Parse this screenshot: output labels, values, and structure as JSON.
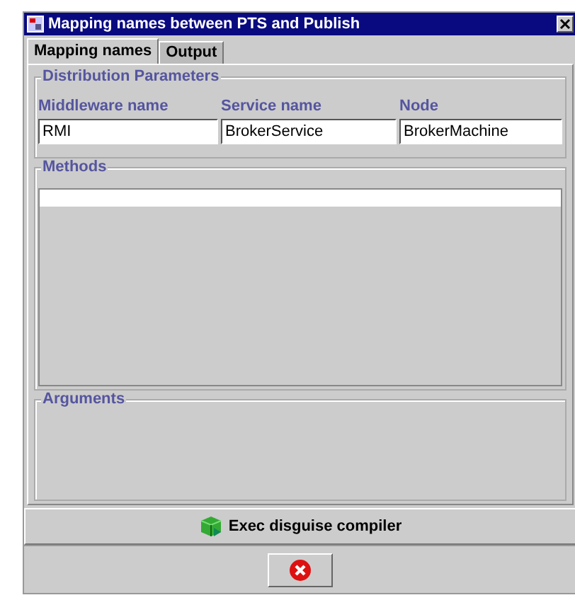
{
  "window": {
    "title": "Mapping names between PTS and Publish"
  },
  "tabs": [
    {
      "label": "Mapping names",
      "selected": true
    },
    {
      "label": "Output",
      "selected": false
    }
  ],
  "distribution_parameters": {
    "title": "Distribution Parameters",
    "fields": [
      {
        "label": "Middleware name",
        "value": "RMI"
      },
      {
        "label": "Service name",
        "value": "BrokerService"
      },
      {
        "label": "Node",
        "value": "BrokerMachine"
      }
    ]
  },
  "methods": {
    "title": "Methods"
  },
  "arguments": {
    "title": "Arguments"
  },
  "exec_button": {
    "label": "Exec disguise compiler"
  }
}
